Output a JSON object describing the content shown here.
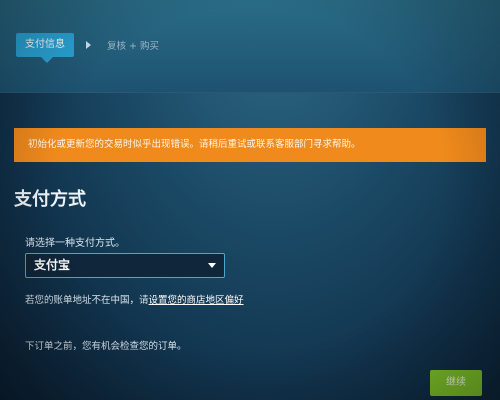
{
  "colors": {
    "accent": "#2aa5d6",
    "warning": "#f08a1c",
    "continue": "#7fc42a"
  },
  "steps": {
    "current": "支付信息",
    "next": "复核 + 购买"
  },
  "error_message": "初始化或更新您的交易时似乎出现错误。请稍后重试或联系客服部门寻求帮助。",
  "payment": {
    "title": "支付方式",
    "prompt": "请选择一种支付方式。",
    "selected_method": "支付宝",
    "region_note_prefix": "若您的账单地址不在中国，请",
    "region_link": "设置您的商店地区偏好"
  },
  "review_note": "下订单之前，您有机会检查您的订单。",
  "continue_label": "继续"
}
